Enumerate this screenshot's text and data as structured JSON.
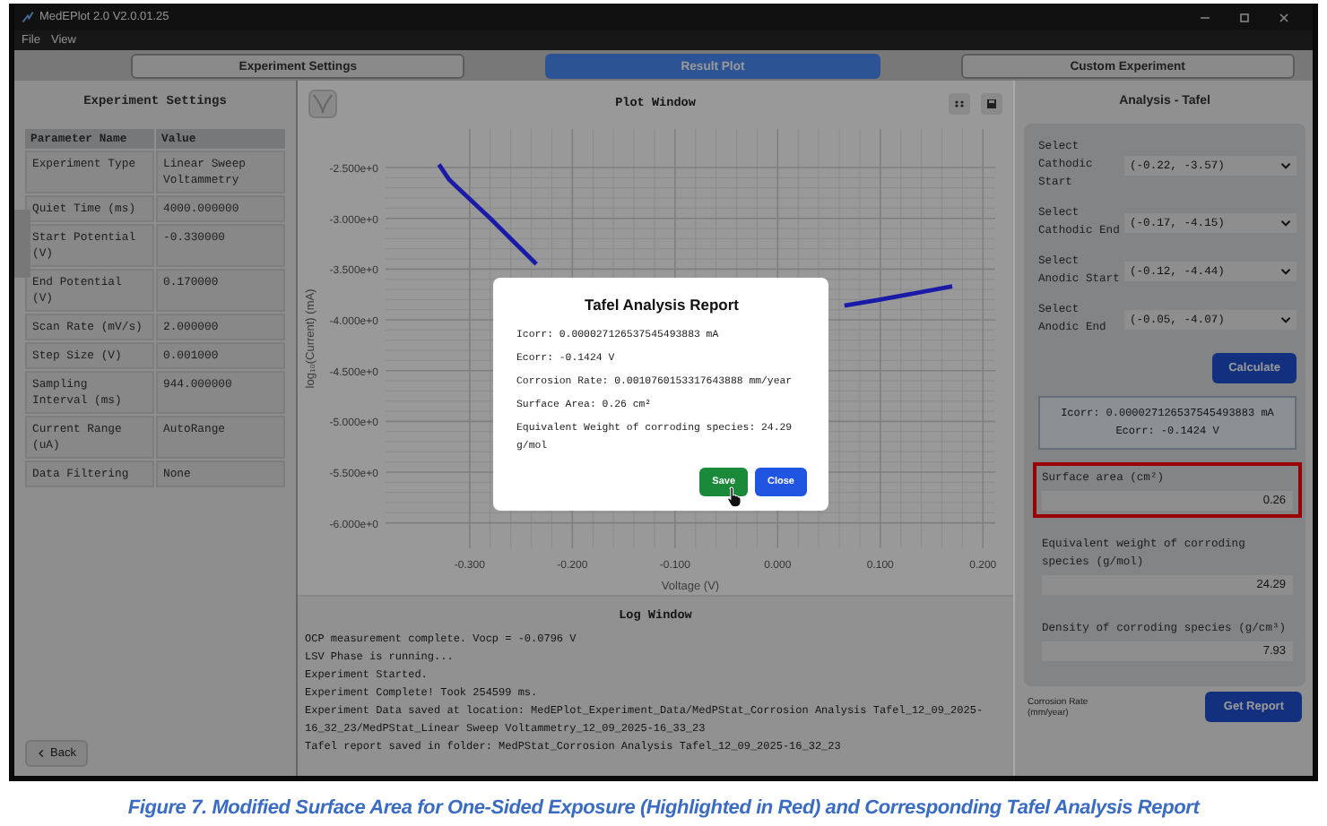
{
  "window": {
    "title": "MedEPlot 2.0 V2.0.01.25"
  },
  "menu": [
    "File",
    "View"
  ],
  "tabs": [
    {
      "label": "Experiment Settings",
      "selected": false
    },
    {
      "label": "Result Plot",
      "selected": true
    },
    {
      "label": "Custom Experiment",
      "selected": false
    }
  ],
  "settings_panel": {
    "title": "Experiment Settings",
    "columns": [
      "Parameter Name",
      "Value"
    ],
    "rows": [
      [
        "Experiment Type",
        "Linear Sweep Voltammetry"
      ],
      [
        "Quiet Time (ms)",
        "4000.000000"
      ],
      [
        "Start Potential (V)",
        "-0.330000"
      ],
      [
        "End Potential (V)",
        "0.170000"
      ],
      [
        "Scan Rate (mV/s)",
        "2.000000"
      ],
      [
        "Step Size (V)",
        "0.001000"
      ],
      [
        "Sampling Interval (ms)",
        "944.000000"
      ],
      [
        "Current Range (uA)",
        "AutoRange"
      ],
      [
        "Data Filtering",
        "None"
      ]
    ],
    "back_button": "Back"
  },
  "plot_window": {
    "title": "Plot Window",
    "chart_data": {
      "type": "line",
      "xlabel": "Voltage (V)",
      "ylabel": "log₁₀(Current) (mA)",
      "x": [
        -0.33,
        -0.32,
        -0.28,
        -0.235,
        0.065,
        0.1,
        0.17
      ],
      "series": [
        {
          "color": "#1a1aa8",
          "values": [
            -2.47,
            -2.62,
            -3.0,
            -3.45,
            -3.86,
            -3.8,
            -3.67
          ]
        }
      ],
      "grid": true,
      "xlim": [
        -0.382,
        0.212
      ],
      "ylim": [
        -6.25,
        -2.12
      ],
      "xticks": [
        {
          "value": -0.3,
          "label": "-0.300"
        },
        {
          "value": -0.2,
          "label": "-0.200"
        },
        {
          "value": -0.1,
          "label": "-0.100"
        },
        {
          "value": 0,
          "label": "0.000"
        },
        {
          "value": 0.1,
          "label": "0.100"
        },
        {
          "value": 0.2,
          "label": "0.200"
        }
      ],
      "yticks": [
        {
          "value": -2.5,
          "label": "-2.500e+0"
        },
        {
          "value": -3,
          "label": "-3.000e+0"
        },
        {
          "value": -3.5,
          "label": "-3.500e+0"
        },
        {
          "value": -4,
          "label": "-4.000e+0"
        },
        {
          "value": -4.5,
          "label": "-4.500e+0"
        },
        {
          "value": -5,
          "label": "-5.000e+0"
        },
        {
          "value": -5.5,
          "label": "-5.500e+0"
        },
        {
          "value": -6,
          "label": "-6.000e+0"
        }
      ]
    }
  },
  "log_window": {
    "title": "Log Window",
    "lines": [
      "OCP measurement complete. Vocp = -0.0796 V",
      "LSV Phase is running...",
      "Experiment Started.",
      "Experiment Complete! Took 254599 ms.",
      "Experiment Data saved at location: MedEPlot_Experiment_Data/MedPStat_Corrosion Analysis Tafel_12_09_2025-16_32_23/MedPStat_Linear Sweep Voltammetry_12_09_2025-16_33_23",
      "Tafel report saved in folder: MedPStat_Corrosion Analysis Tafel_12_09_2025-16_32_23"
    ]
  },
  "analysis_panel": {
    "title": "Analysis - Tafel",
    "selects": [
      {
        "label": "Select Cathodic Start",
        "value": "(-0.22, -3.57)"
      },
      {
        "label": "Select Cathodic End",
        "value": "(-0.17, -4.15)"
      },
      {
        "label": "Select Anodic Start",
        "value": "(-0.12, -4.44)"
      },
      {
        "label": "Select Anodic End",
        "value": "(-0.05, -4.07)"
      }
    ],
    "calculate_button": "Calculate",
    "result": [
      "Icorr: 0.000027126537545493883 mA",
      "Ecorr: -0.1424 V"
    ],
    "fields": [
      {
        "label": "Surface area (cm²)",
        "value": "0.26",
        "highlighted": true
      },
      {
        "label": "Equivalent weight of corroding species (g/mol)",
        "value": "24.29",
        "highlighted": false
      },
      {
        "label": "Density of corroding species (g/cm³)",
        "value": "7.93",
        "highlighted": false
      }
    ],
    "corrosion_rate_label": "Corrosion Rate (mm/year)",
    "report_button": "Get Report"
  },
  "dialog": {
    "open": true,
    "title": "Tafel Analysis Report",
    "lines": [
      "Icorr: 0.000027126537545493883 mA",
      "Ecorr: -0.1424 V",
      "Corrosion Rate: 0.0010760153317643888 mm/year",
      "Surface Area: 0.26 cm²",
      "Equivalent Weight of corroding species: 24.29 g/mol"
    ],
    "buttons": [
      {
        "label": "Save",
        "kind": "confirm"
      },
      {
        "label": "Close",
        "kind": "dismiss"
      }
    ]
  },
  "caption": "Figure 7. Modified Surface Area for One-Sided Exposure (Highlighted in Red) and Corresponding Tafel Analysis Report"
}
